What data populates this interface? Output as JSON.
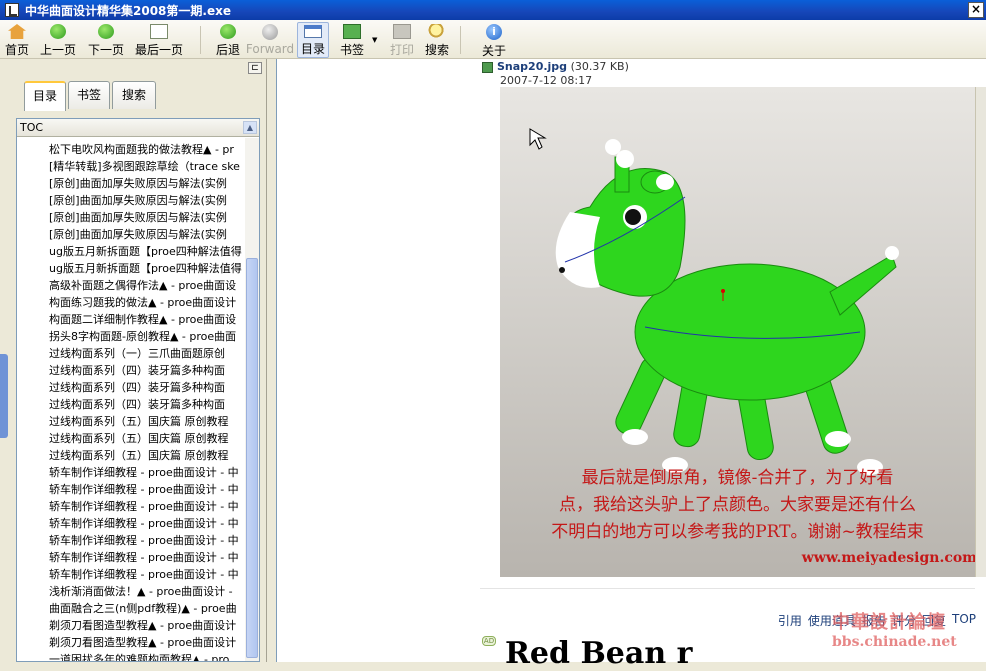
{
  "window": {
    "title": "中华曲面设计精华集2008第一期.exe",
    "close": "×"
  },
  "toolbar": {
    "home": "首页",
    "prev": "上一页",
    "next": "下一页",
    "last": "最后一页",
    "back": "后退",
    "forward": "Forward",
    "toc": "目录",
    "bookmark": "书签",
    "print": "打印",
    "search": "搜索",
    "about": "关于"
  },
  "sidebar": {
    "tabs": [
      "目录",
      "书签",
      "搜索"
    ],
    "header": "TOC",
    "items": [
      "松下电吹风构面题我的做法教程▲ - pr",
      "[精华转载]多视图跟踪草绘（trace ske",
      "[原创]曲面加厚失败原因与解法(实例",
      "[原创]曲面加厚失败原因与解法(实例",
      "[原创]曲面加厚失败原因与解法(实例",
      "[原创]曲面加厚失败原因与解法(实例",
      "ug版五月新拆面题【proe四种解法值得",
      "ug版五月新拆面题【proe四种解法值得",
      "高级补面题之偶得作法▲ - proe曲面设",
      "构面练习题我的做法▲ - proe曲面设计",
      "构面题二详细制作教程▲ - proe曲面设",
      "拐头8字构面题-原创教程▲ - proe曲面",
      "过线构面系列（一）三爪曲面题原创",
      "过线构面系列（四）装牙篇多种构面",
      "过线构面系列（四）装牙篇多种构面",
      "过线构面系列（四）装牙篇多种构面",
      "过线构面系列（五）国庆篇 原创教程",
      "过线构面系列（五）国庆篇 原创教程",
      "过线构面系列（五）国庆篇 原创教程",
      "轿车制作详细教程 - proe曲面设计 - 中",
      "轿车制作详细教程 - proe曲面设计 - 中",
      "轿车制作详细教程 - proe曲面设计 - 中",
      "轿车制作详细教程 - proe曲面设计 - 中",
      "轿车制作详细教程 - proe曲面设计 - 中",
      "轿车制作详细教程 - proe曲面设计 - 中",
      "轿车制作详细教程 - proe曲面设计 - 中",
      "浅析渐消面做法！▲ - proe曲面设计 -",
      "曲面融合之三(n侧pdf教程)▲ - proe曲",
      "剃须刀看图造型教程▲ - proe曲面设计",
      "剃须刀看图造型教程▲ - proe曲面设计",
      "一道困扰多年的难题构面教程▲ - pro"
    ]
  },
  "main": {
    "attachment_name": "Snap20.jpg",
    "attachment_size": "(30.37 KB)",
    "attachment_date": "2007-7-12 08:17",
    "caption_lines": [
      "最后就是倒原角，镜像-合并了，为了好看",
      "点，我给这头驴上了点颜色。大家要是还有什么",
      "不明白的地方可以参考我的PRT。谢谢~教程结束"
    ],
    "watermark": "www.meiyadesign.com",
    "actions": [
      "引用",
      "使用道具",
      "报告",
      "评分",
      "回复",
      "TOP"
    ],
    "ad_badge": "AD",
    "next_title": "Red Bean r",
    "stamp_cn": "中華設計論壇",
    "stamp_url": "bbs.chinade.net"
  },
  "colors": {
    "model": "#2ED61E",
    "caption": "#C41818",
    "titlebar": "#0A5FD8"
  }
}
